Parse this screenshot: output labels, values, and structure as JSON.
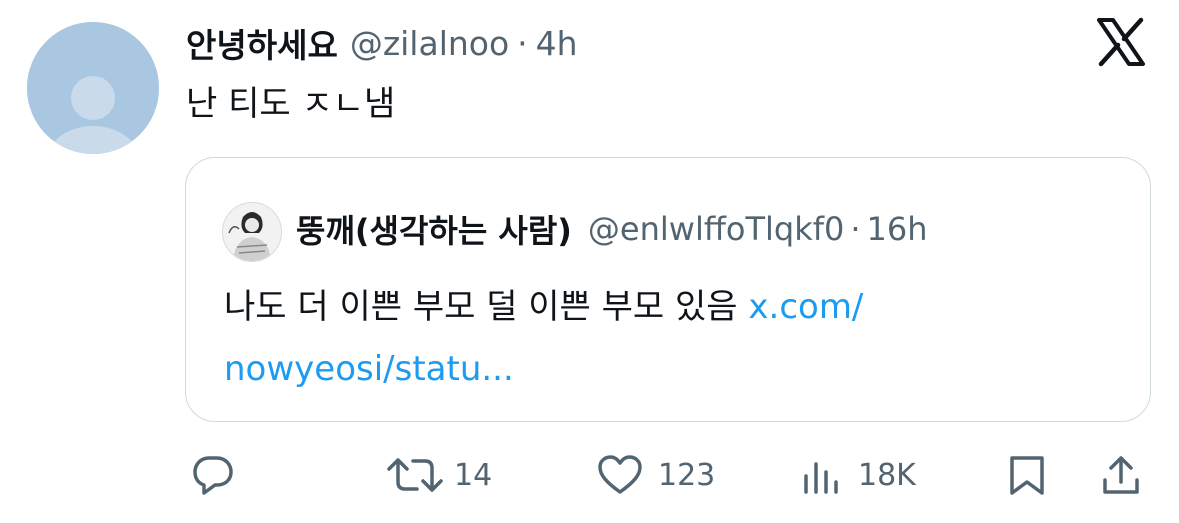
{
  "tweet": {
    "display_name": "안녕하세요",
    "handle": "@zilalnoo",
    "separator": "·",
    "time": "4h",
    "text": "난 티도 ㅈㄴ냄"
  },
  "quoted_tweet": {
    "display_name": "뚱깨(생각하는 사람)",
    "handle": "@enlwlffoTlqkf0",
    "separator": "·",
    "time": "16h",
    "text": "나도 더 이쁜 부모 덜 이쁜 부모 있음 ",
    "link_text": "x.com/\nnowyeosi/statu..."
  },
  "actions": {
    "reply": {
      "icon": "reply-icon"
    },
    "retweet": {
      "icon": "retweet-icon",
      "count": "14"
    },
    "like": {
      "icon": "heart-icon",
      "count": "123"
    },
    "views": {
      "icon": "views-icon",
      "count": "18K"
    },
    "bookmark": {
      "icon": "bookmark-icon"
    },
    "share": {
      "icon": "share-icon"
    }
  },
  "colors": {
    "link": "#1d9bf0",
    "muted": "#536471",
    "text": "#0f1419",
    "border": "#cfd9de",
    "default_avatar": "#a9c7e1"
  }
}
